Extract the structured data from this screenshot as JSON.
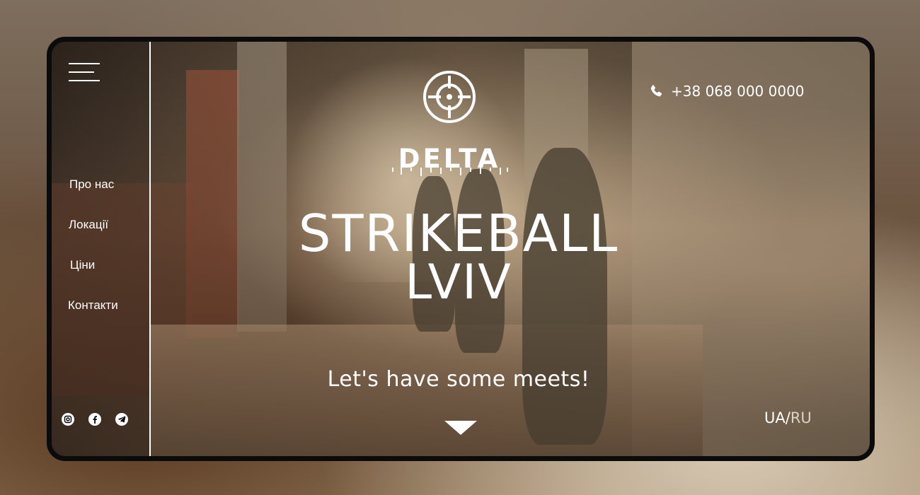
{
  "nav": {
    "items": [
      "Про нас",
      "Локації",
      "Ціни",
      "Контакти"
    ]
  },
  "brand": {
    "name": "DELTA"
  },
  "hero": {
    "title_line1": "STRIKEBALL",
    "title_line2": "LVIV",
    "tagline": "Let's have some meets!"
  },
  "contact": {
    "phone": "+38 068 000 0000"
  },
  "language": {
    "ua": "UA",
    "separator": "/",
    "ru": "RU"
  },
  "socials": [
    "instagram-icon",
    "facebook-icon",
    "telegram-icon"
  ],
  "colors": {
    "text": "#ffffff",
    "frame": "#0b0b0b"
  }
}
